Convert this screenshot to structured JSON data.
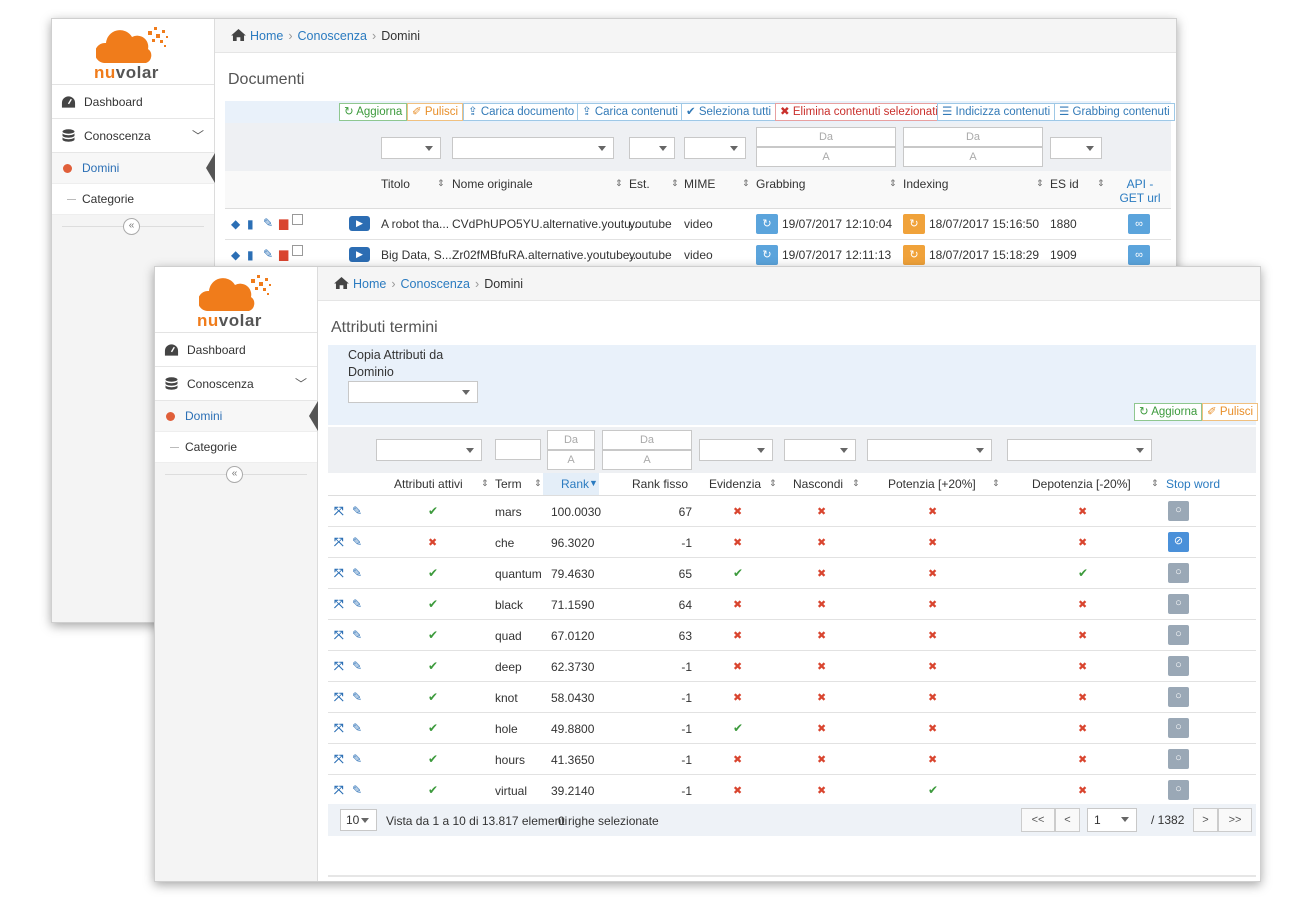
{
  "brand": {
    "name_a": "nu",
    "name_b": "volar",
    "orange": "#f07c1b"
  },
  "sidebar": {
    "items": [
      {
        "label": "Dashboard",
        "icon": "dashboard-icon"
      },
      {
        "label": "Conoscenza",
        "icon": "database-icon"
      }
    ],
    "sub_items": [
      {
        "label": "Domini",
        "active": true
      },
      {
        "label": "Categorie",
        "active": false
      }
    ],
    "collapse_label": "«"
  },
  "breadcrumb": {
    "home": "Home",
    "level1": "Conoscenza",
    "current": "Domini",
    "sep": "›"
  },
  "documents": {
    "title": "Documenti",
    "toolbar": [
      {
        "label": "Aggiorna",
        "icon": "↻",
        "style": "g"
      },
      {
        "label": "Pulisci",
        "icon": "✐",
        "style": "o"
      },
      {
        "label": "Carica documento",
        "icon": "⇪",
        "style": "b"
      },
      {
        "label": "Carica contenuti",
        "icon": "⇪",
        "style": "b"
      },
      {
        "label": "Seleziona tutti",
        "icon": "✔",
        "style": "b"
      },
      {
        "label": "Elimina contenuti selezionati",
        "icon": "✖",
        "style": "r"
      },
      {
        "label": "Indicizza contenuti",
        "icon": "☰",
        "style": "b"
      },
      {
        "label": "Grabbing contenuti",
        "icon": "☰",
        "style": "b"
      }
    ],
    "filters": {
      "da": "Da",
      "a": "A"
    },
    "columns": [
      "Titolo",
      "Nome originale",
      "Est.",
      "MIME",
      "Grabbing",
      "Indexing",
      "ES id",
      "API - GET url"
    ],
    "rows": [
      {
        "titolo": "A robot tha...",
        "nome": "CVdPhUPO5YU.alternative.youtu...",
        "est": "youtube",
        "mime": "video",
        "grabbing": "19/07/2017 12:10:04",
        "indexing": "18/07/2017 15:16:50",
        "es_id": "1880"
      },
      {
        "titolo": "Big Data, S...",
        "nome": "Zr02fMBfuRA.alternative.youtube...",
        "est": "youtube",
        "mime": "video",
        "grabbing": "19/07/2017 12:11:13",
        "indexing": "18/07/2017 15:18:29",
        "es_id": "1909"
      }
    ]
  },
  "attributes": {
    "title": "Attributi termini",
    "copy_label": "Copia Attributi da Dominio",
    "btn_refresh": "Aggiorna",
    "btn_clear": "Pulisci",
    "filters": {
      "da": "Da",
      "a": "A"
    },
    "columns": [
      "Attributi attivi",
      "Term",
      "Rank",
      "Rank fisso",
      "Evidenzia",
      "Nascondi",
      "Potenzia [+20%]",
      "Depotenzia [-20%]",
      "Stop word"
    ],
    "rows": [
      {
        "attivi": true,
        "term": "mars",
        "rank": "100.0030",
        "fisso": "67",
        "evid": false,
        "nasc": false,
        "pot": false,
        "depot": false,
        "stop": false
      },
      {
        "attivi": false,
        "term": "che",
        "rank": "96.3020",
        "fisso": "-1",
        "evid": false,
        "nasc": false,
        "pot": false,
        "depot": false,
        "stop": true
      },
      {
        "attivi": true,
        "term": "quantum",
        "rank": "79.4630",
        "fisso": "65",
        "evid": true,
        "nasc": false,
        "pot": false,
        "depot": true,
        "stop": false
      },
      {
        "attivi": true,
        "term": "black",
        "rank": "71.1590",
        "fisso": "64",
        "evid": false,
        "nasc": false,
        "pot": false,
        "depot": false,
        "stop": false
      },
      {
        "attivi": true,
        "term": "quad",
        "rank": "67.0120",
        "fisso": "63",
        "evid": false,
        "nasc": false,
        "pot": false,
        "depot": false,
        "stop": false
      },
      {
        "attivi": true,
        "term": "deep",
        "rank": "62.3730",
        "fisso": "-1",
        "evid": false,
        "nasc": false,
        "pot": false,
        "depot": false,
        "stop": false
      },
      {
        "attivi": true,
        "term": "knot",
        "rank": "58.0430",
        "fisso": "-1",
        "evid": false,
        "nasc": false,
        "pot": false,
        "depot": false,
        "stop": false
      },
      {
        "attivi": true,
        "term": "hole",
        "rank": "49.8800",
        "fisso": "-1",
        "evid": true,
        "nasc": false,
        "pot": false,
        "depot": false,
        "stop": false
      },
      {
        "attivi": true,
        "term": "hours",
        "rank": "41.3650",
        "fisso": "-1",
        "evid": false,
        "nasc": false,
        "pot": false,
        "depot": false,
        "stop": false
      },
      {
        "attivi": true,
        "term": "virtual",
        "rank": "39.2140",
        "fisso": "-1",
        "evid": false,
        "nasc": false,
        "pot": true,
        "depot": false,
        "stop": false
      }
    ],
    "footer": {
      "page_size": "10",
      "info": "Vista da 1 a 10 di 13.817 elementi",
      "selected": "0 righe selezionate",
      "first": "<<",
      "prev": "<",
      "page": "1",
      "total": "/ 1382",
      "next": ">",
      "last": ">>"
    }
  },
  "colors": {
    "accent": "#2b7bc0",
    "check": "#3c9a3c",
    "cross": "#d9452f"
  }
}
